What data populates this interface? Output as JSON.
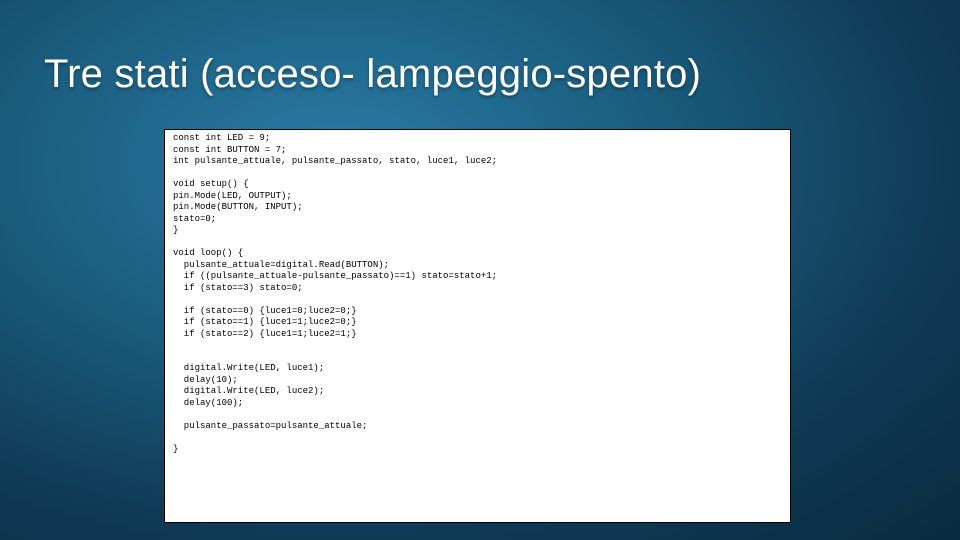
{
  "slide": {
    "title": "Tre stati (acceso- lampeggio-spento)",
    "code": "const int LED = 9;\nconst int BUTTON = 7;\nint pulsante_attuale, pulsante_passato, stato, luce1, luce2;\n\nvoid setup() {\npin.Mode(LED, OUTPUT);\npin.Mode(BUTTON, INPUT);\nstato=0;\n}\n\nvoid loop() {\n  pulsante_attuale=digital.Read(BUTTON);\n  if ((pulsante_attuale-pulsante_passato)==1) stato=stato+1;\n  if (stato==3) stato=0;\n\n  if (stato==0) {luce1=0;luce2=0;}\n  if (stato==1) {luce1=1;luce2=0;}\n  if (stato==2) {luce1=1;luce2=1;}\n\n\n  digital.Write(LED, luce1);\n  delay(10);\n  digital.Write(LED, luce2);\n  delay(100);\n\n  pulsante_passato=pulsante_attuale;\n\n}"
  }
}
